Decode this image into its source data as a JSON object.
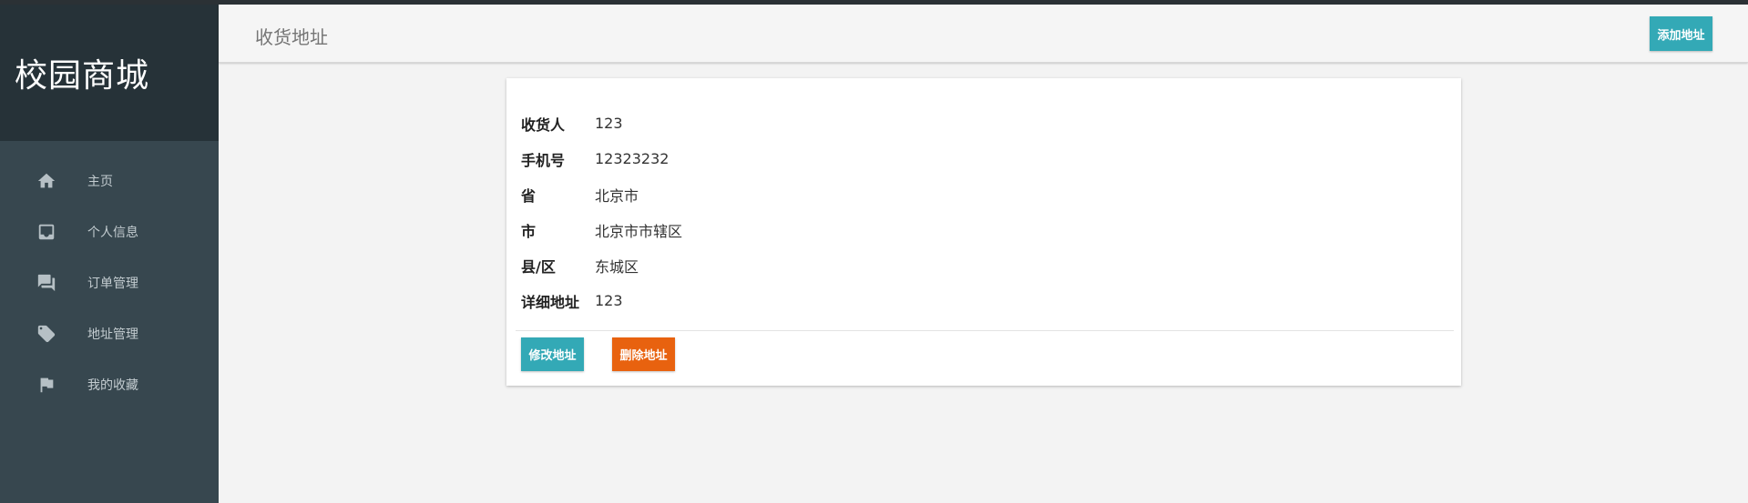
{
  "app": {
    "title": "校园商城"
  },
  "sidebar": {
    "items": [
      {
        "label": "主页",
        "icon": "home-icon"
      },
      {
        "label": "个人信息",
        "icon": "inbox-icon"
      },
      {
        "label": "订单管理",
        "icon": "chat-icon"
      },
      {
        "label": "地址管理",
        "icon": "tag-icon"
      },
      {
        "label": "我的收藏",
        "icon": "flag-icon"
      }
    ]
  },
  "header": {
    "title": "收货地址",
    "add_label": "添加地址"
  },
  "address": {
    "fields": [
      {
        "label": "收货人",
        "value": "123"
      },
      {
        "label": "手机号",
        "value": "12323232"
      },
      {
        "label": "省",
        "value": "北京市"
      },
      {
        "label": "市",
        "value": "北京市市辖区"
      },
      {
        "label": "县/区",
        "value": "东城区"
      },
      {
        "label": "详细地址",
        "value": "123"
      }
    ],
    "edit_label": "修改地址",
    "delete_label": "删除地址"
  },
  "colors": {
    "sidebar_bg": "#37474f",
    "brand_bg": "#263238",
    "accent": "#33a9b6",
    "danger": "#e8620f"
  }
}
